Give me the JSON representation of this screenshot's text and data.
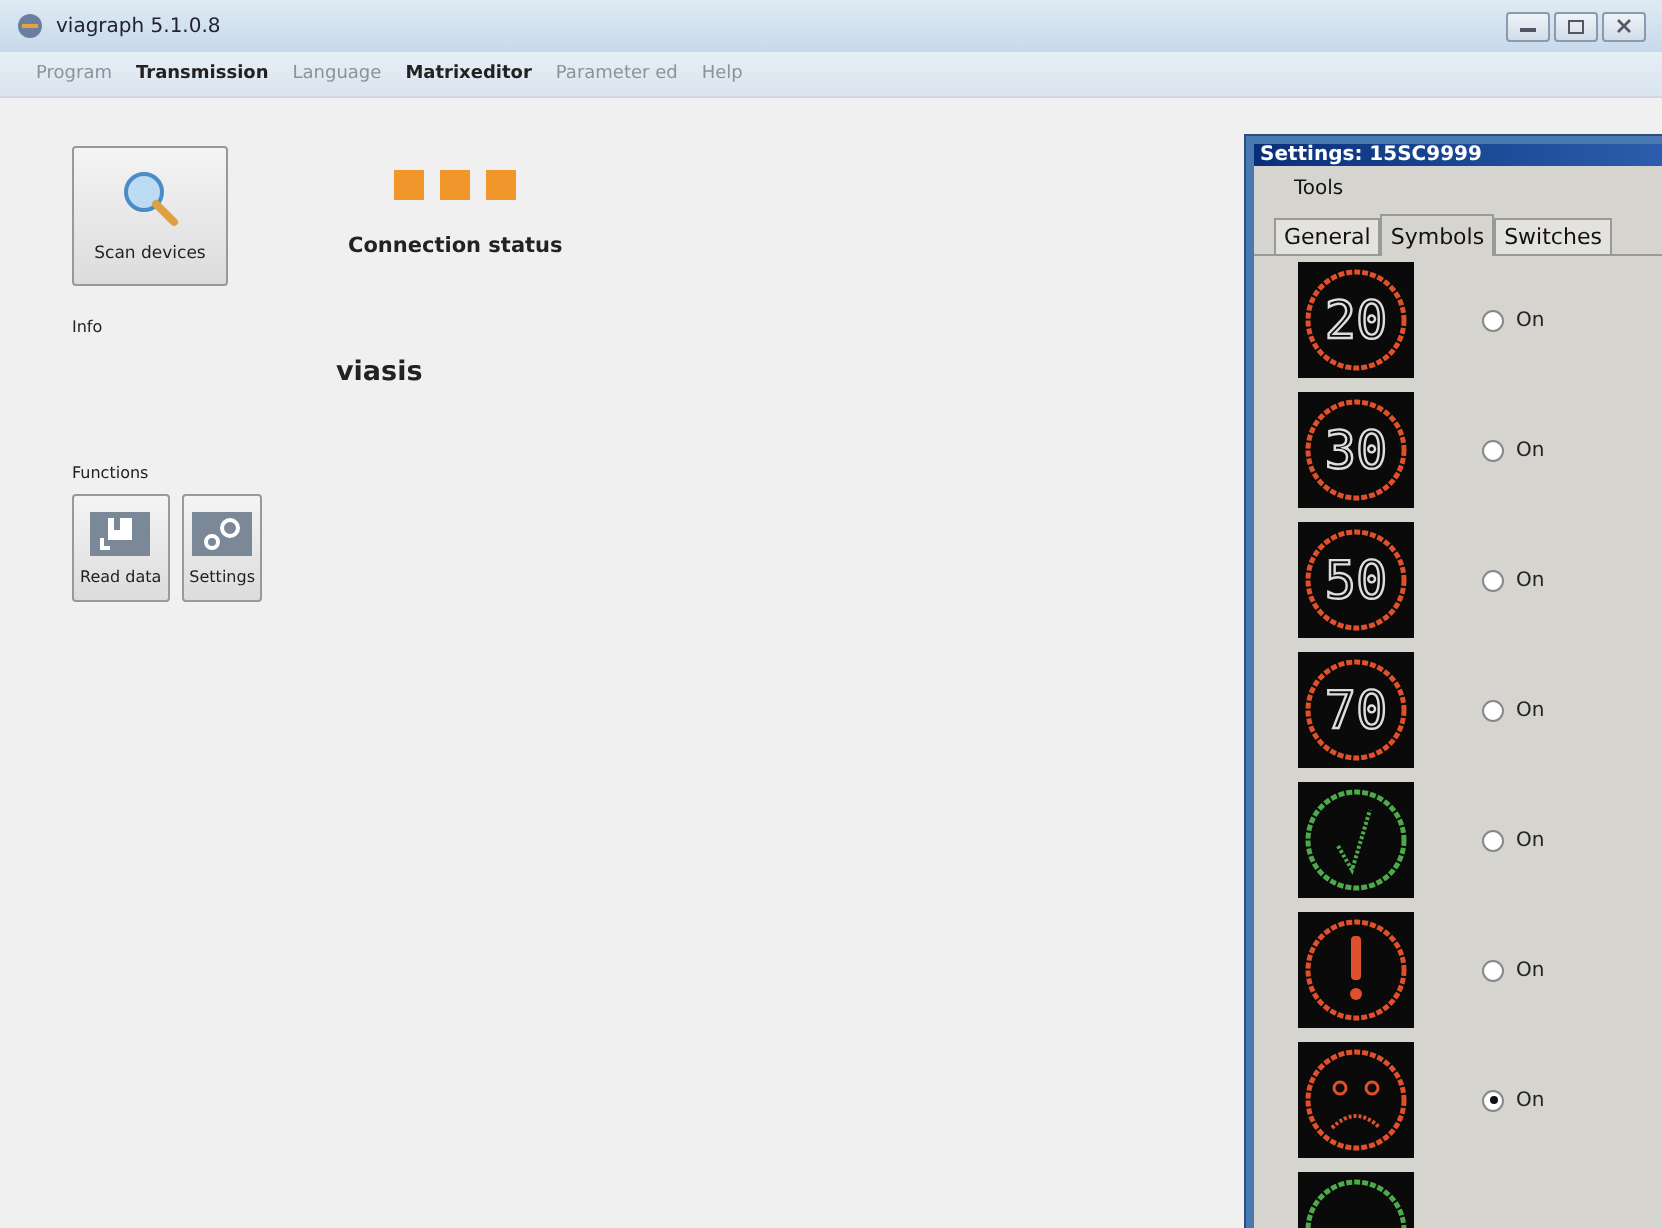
{
  "window": {
    "title": "viagraph 5.1.0.8"
  },
  "menu": [
    {
      "label": "Program",
      "disabled": true
    },
    {
      "label": "Transmission",
      "disabled": false
    },
    {
      "label": "Language",
      "disabled": true
    },
    {
      "label": "Matrixeditor",
      "disabled": false
    },
    {
      "label": "Parameter ed",
      "disabled": true
    },
    {
      "label": "Help",
      "disabled": true
    }
  ],
  "scan_button": {
    "label": "Scan devices"
  },
  "connection": {
    "label": "Connection status"
  },
  "info": {
    "label": "Info",
    "value": "viasis"
  },
  "functions": {
    "label": "Functions",
    "buttons": [
      {
        "kind": "read",
        "label": "Read data"
      },
      {
        "kind": "settings",
        "label": "Settings"
      }
    ]
  },
  "dialog": {
    "title": "Settings: 15SC9999",
    "menu": [
      "Tools"
    ],
    "tabs": [
      {
        "label": "General",
        "selected": false
      },
      {
        "label": "Symbols",
        "selected": true
      },
      {
        "label": "Switches",
        "selected": false
      }
    ],
    "symbols": [
      {
        "kind": "number",
        "text": "20",
        "color": "#e0502a",
        "label": "On",
        "selected": false
      },
      {
        "kind": "number",
        "text": "30",
        "color": "#e0502a",
        "label": "On",
        "selected": false
      },
      {
        "kind": "number",
        "text": "50",
        "color": "#e0502a",
        "label": "On",
        "selected": false
      },
      {
        "kind": "number",
        "text": "70",
        "color": "#e0502a",
        "label": "On",
        "selected": false
      },
      {
        "kind": "check",
        "color": "#4caa4c",
        "label": "On",
        "selected": false
      },
      {
        "kind": "exclamation",
        "color": "#e0502a",
        "label": "On",
        "selected": false
      },
      {
        "kind": "frown",
        "color": "#e0502a",
        "label": "On",
        "selected": true
      },
      {
        "kind": "ring",
        "color": "#4caa4c"
      }
    ]
  }
}
